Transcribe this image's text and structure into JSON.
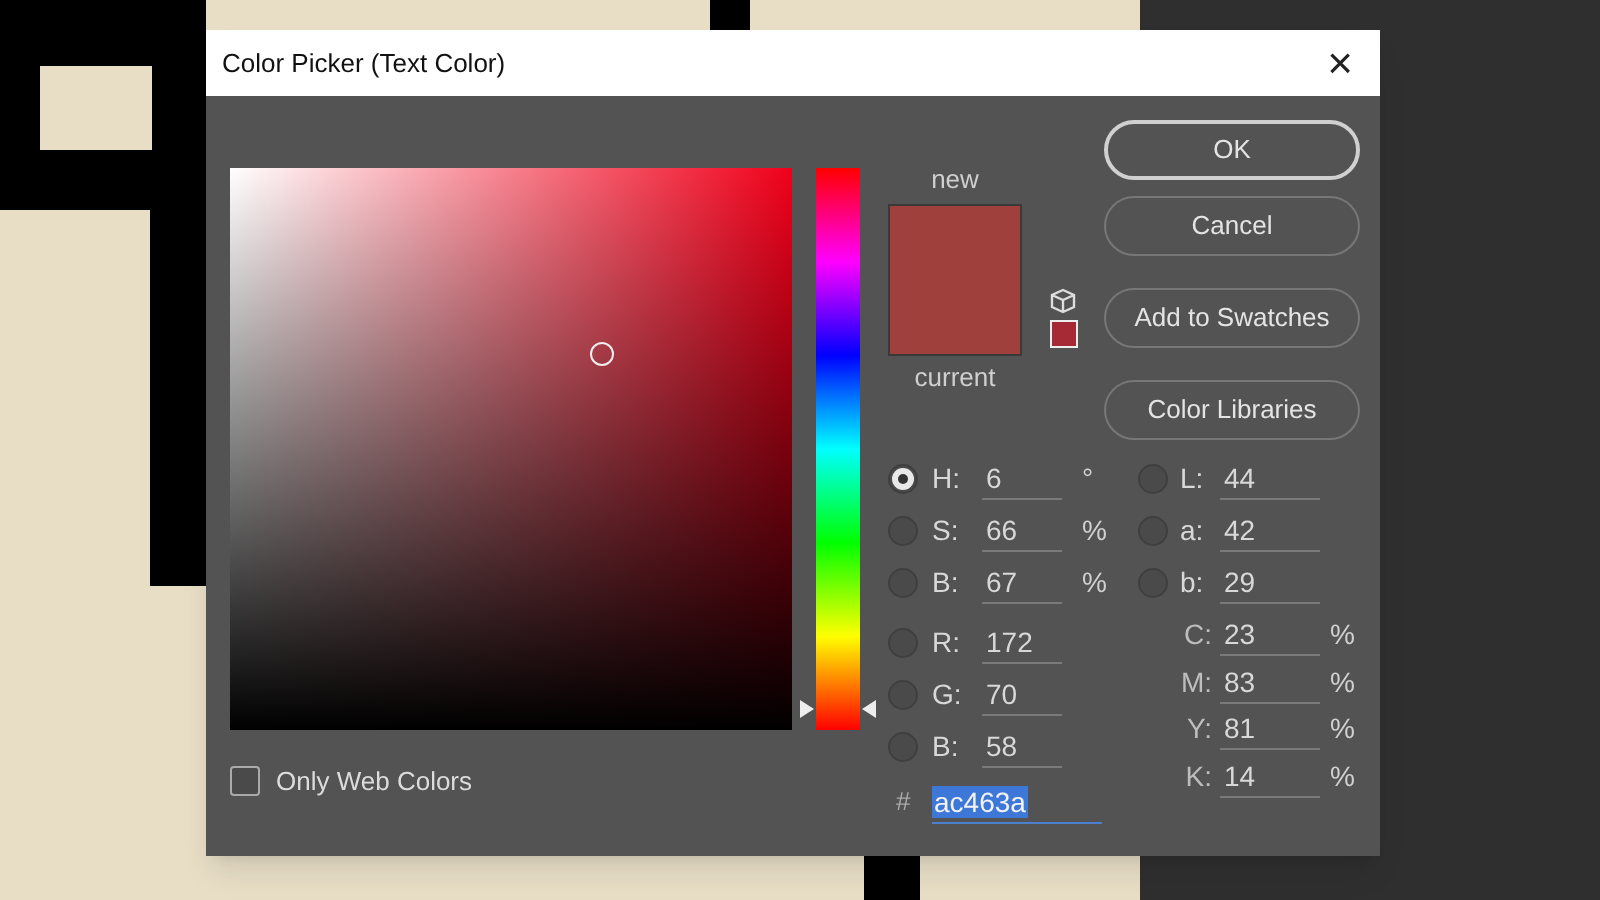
{
  "dialog": {
    "title": "Color Picker (Text Color)",
    "close": "×"
  },
  "swatch": {
    "new_label": "new",
    "current_label": "current"
  },
  "hue_slider": {
    "level": 0.02
  },
  "buttons": [
    {
      "label": "OK",
      "kind": "primary"
    },
    {
      "label": "Cancel",
      "kind": "normal"
    },
    {
      "label": "Add to Swatches",
      "kind": "normal"
    },
    {
      "label": "Color Libraries",
      "kind": "normal"
    }
  ],
  "web_colors": {
    "label": "Only Web Colors",
    "checked": false
  },
  "left_fields": [
    {
      "label": "H:",
      "value": "6",
      "unit": "°",
      "selected": true
    },
    {
      "label": "S:",
      "value": "66",
      "unit": "%",
      "selected": false
    },
    {
      "label": "B:",
      "value": "67",
      "unit": "%",
      "selected": false
    },
    {
      "label": "R:",
      "value": "172",
      "selected": false
    },
    {
      "label": "G:",
      "value": "70",
      "selected": false
    },
    {
      "label": "B:",
      "value": "58",
      "selected": false
    }
  ],
  "right_fields": [
    {
      "kind": "radio",
      "label": "L:",
      "value": "44",
      "selected": false
    },
    {
      "kind": "radio",
      "label": "a:",
      "value": "42",
      "selected": false
    },
    {
      "kind": "radio",
      "label": "b:",
      "value": "29",
      "selected": false
    },
    {
      "kind": "plain",
      "label": "C:",
      "value": "23",
      "unit": "%"
    },
    {
      "kind": "plain",
      "label": "M:",
      "value": "83",
      "unit": "%"
    },
    {
      "kind": "plain",
      "label": "Y:",
      "value": "81",
      "unit": "%"
    },
    {
      "kind": "plain",
      "label": "K:",
      "value": "14",
      "unit": "%"
    }
  ],
  "hex": {
    "label": "#",
    "value": "ac463a"
  }
}
